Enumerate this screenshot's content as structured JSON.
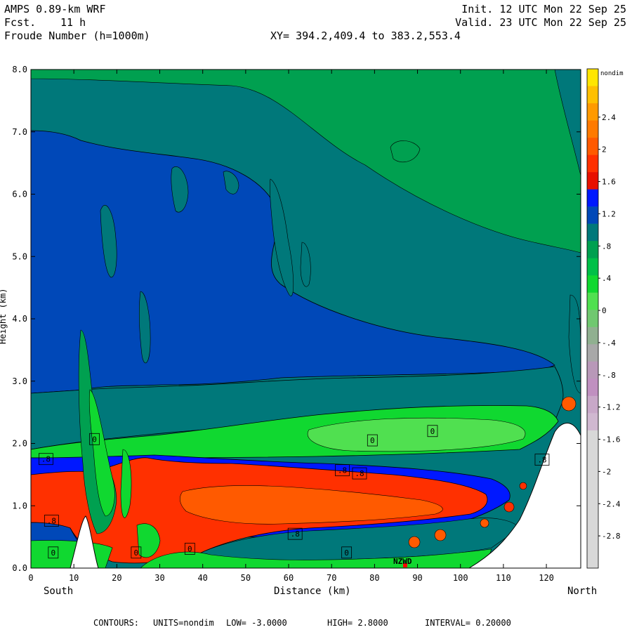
{
  "header": {
    "model": "AMPS 0.89-km WRF",
    "forecast_label": "Fcst.",
    "forecast_value": "11 h",
    "field": "Froude Number (h=1000m)",
    "init": "Init. 12 UTC Mon 22 Sep 25",
    "valid": "Valid. 23 UTC Mon 22 Sep 25",
    "xy": "XY= 394.2,409.4 to 383.2,553.4"
  },
  "footer": {
    "contours": "CONTOURS:",
    "units": "UNITS=nondim",
    "low": "LOW= -3.0000",
    "high": "HIGH= 2.8000",
    "interval": "INTERVAL= 0.20000"
  },
  "chart_data": {
    "type": "heatmap",
    "xlabel": "Distance (km)",
    "ylabel": "Height (km)",
    "xlim": [
      0,
      128
    ],
    "ylim": [
      0.0,
      8.0
    ],
    "x_ticks": [
      "0",
      "10",
      "20",
      "30",
      "40",
      "50",
      "60",
      "70",
      "80",
      "90",
      "100",
      "110",
      "120"
    ],
    "y_ticks": [
      "0.0",
      "1.0",
      "2.0",
      "3.0",
      "4.0",
      "5.0",
      "6.0",
      "7.0",
      "8.0"
    ],
    "x_left_label": "South",
    "x_right_label": "North",
    "station_label": "NZWD",
    "colorbar": {
      "unit_label": "nondim",
      "labels": [
        "2.4",
        "2",
        "1.6",
        "1.2",
        ".8",
        ".4",
        "0",
        "-.4",
        "-.8",
        "-1.2",
        "-1.6",
        "-2",
        "-2.4",
        "-2.8"
      ],
      "label_values": [
        2.4,
        2.0,
        1.6,
        1.2,
        0.8,
        0.4,
        0.0,
        -0.4,
        -0.8,
        -1.2,
        -1.6,
        -2.0,
        -2.4,
        -2.8
      ],
      "colors": [
        "#ffe600",
        "#ffc000",
        "#ff9a00",
        "#ff7a00",
        "#ff5a00",
        "#ff3000",
        "#e81000",
        "#0018ff",
        "#0048b8",
        "#00787a",
        "#00a050",
        "#00c048",
        "#10d830",
        "#50e050",
        "#70c870",
        "#90b090",
        "#a8a8a8",
        "#b898b8",
        "#c090c0",
        "#c8a8c8",
        "#d0b8d0",
        "#d8d8d8",
        "#d8d8d8",
        "#d8d8d8",
        "#d8d8d8",
        "#d8d8d8",
        "#d8d8d8",
        "#d8d8d8",
        "#d8d8d8"
      ]
    },
    "contour_labels": [
      {
        "text": ".8",
        "x": 3.5,
        "y": 1.75
      },
      {
        "text": "0",
        "x": 14.8,
        "y": 2.07
      },
      {
        "text": ".8",
        "x": 4.8,
        "y": 0.76
      },
      {
        "text": "0",
        "x": 5.2,
        "y": 0.25
      },
      {
        "text": "0",
        "x": 24.5,
        "y": 0.25
      },
      {
        "text": "0",
        "x": 37.0,
        "y": 0.31
      },
      {
        "text": ".8",
        "x": 61.5,
        "y": 0.55
      },
      {
        "text": "0",
        "x": 73.5,
        "y": 0.25
      },
      {
        "text": ".8",
        "x": 72.5,
        "y": 1.57
      },
      {
        "text": ".8",
        "x": 76.5,
        "y": 1.52
      },
      {
        "text": "0",
        "x": 79.5,
        "y": 2.05
      },
      {
        "text": "0",
        "x": 93.5,
        "y": 2.2
      },
      {
        "text": ".8",
        "x": 119.0,
        "y": 1.74
      }
    ],
    "colors": {
      "deep_blue": "#0048b8",
      "teal": "#00787a",
      "green": "#00c048",
      "bright_green": "#10d830",
      "red": "#ff3000",
      "orange": "#ff5a00",
      "blue": "#0018ff",
      "terrain": "#ffffff"
    }
  }
}
